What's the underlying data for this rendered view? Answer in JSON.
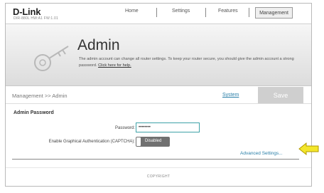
{
  "header": {
    "logo": "D-Link",
    "model_info": "DIR-880L   HW:A1   FW:1.01",
    "nav": [
      "Home",
      "Settings",
      "Features",
      "Management"
    ],
    "active_tab": "Management"
  },
  "banner": {
    "title": "Admin",
    "description": "The admin account can change all router settings. To keep your router secure, you should give the admin account a strong password.",
    "help_link": "Click here for help."
  },
  "toolbar": {
    "breadcrumb": "Management >> Admin",
    "system_link": "System",
    "save_label": "Save"
  },
  "form": {
    "section_title": "Admin Password",
    "password_label": "Password:",
    "password_value": "••••••••",
    "captcha_label": "Enable Graphical Authentication (CAPTCHA):",
    "captcha_state": "Disabled",
    "advanced_link": "Advanced Settings..."
  },
  "footer": {
    "copyright": "COPYRIGHT"
  },
  "colors": {
    "link": "#2a7fa8",
    "input_border": "#3fa2a8",
    "arrow_fill": "#f3e62b",
    "arrow_stroke": "#b29a00"
  },
  "icons": {
    "banner": "key-icon",
    "annotation": "arrow-left-icon"
  }
}
